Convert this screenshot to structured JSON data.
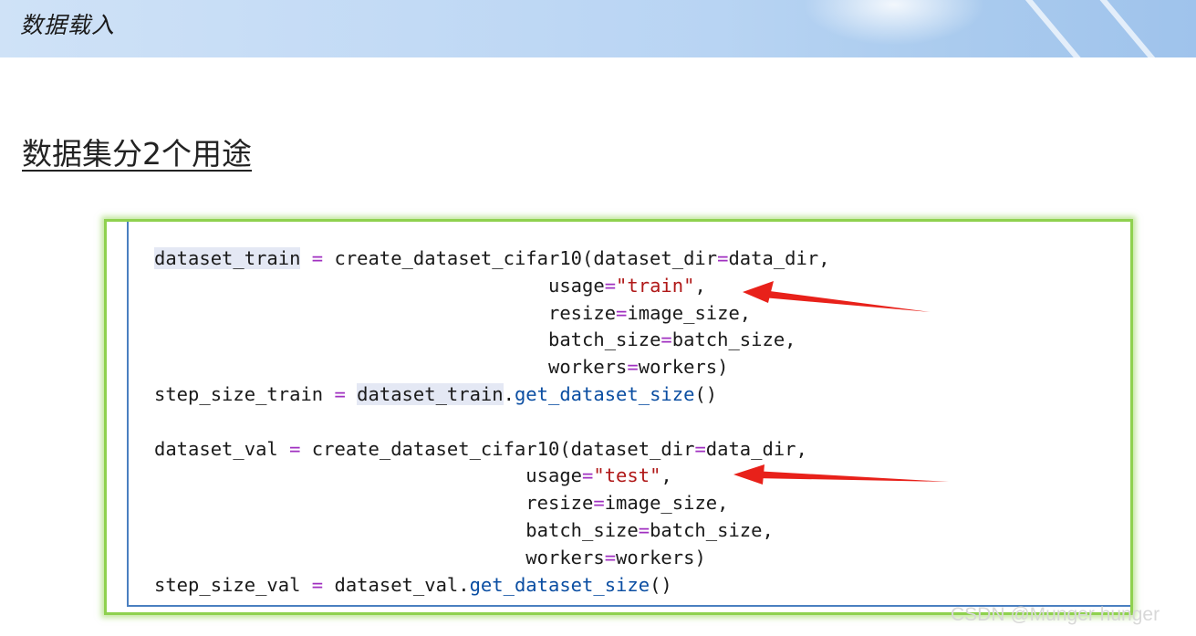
{
  "header": {
    "title": "数据载入"
  },
  "slide": {
    "title": "数据集分2个用途"
  },
  "code": {
    "block1": {
      "var": "dataset_train",
      "eq": "=",
      "call": "create_dataset_cifar10(dataset_dir",
      "eq2": "=",
      "arg1": "data_dir,",
      "usage_kw": "usage",
      "usage_eq": "=",
      "usage_val": "\"train\"",
      "usage_tail": ",",
      "resize_kw": "resize",
      "resize_eq": "=",
      "resize_val": "image_size,",
      "batch_kw": "batch_size",
      "batch_eq": "=",
      "batch_val": "batch_size,",
      "workers_kw": "workers",
      "workers_eq": "=",
      "workers_val": "workers)",
      "step_var": "step_size_train",
      "step_eq": "=",
      "step_obj": "dataset_train",
      "step_dot": ".",
      "step_fn": "get_dataset_size",
      "step_tail": "()"
    },
    "block2": {
      "var": "dataset_val",
      "eq": "=",
      "call": "create_dataset_cifar10(dataset_dir",
      "eq2": "=",
      "arg1": "data_dir,",
      "usage_kw": "usage",
      "usage_eq": "=",
      "usage_val": "\"test\"",
      "usage_tail": ",",
      "resize_kw": "resize",
      "resize_eq": "=",
      "resize_val": "image_size,",
      "batch_kw": "batch_size",
      "batch_eq": "=",
      "batch_val": "batch_size,",
      "workers_kw": "workers",
      "workers_eq": "=",
      "workers_val": "workers)",
      "step_var": "step_size_val",
      "step_eq": "=",
      "step_obj": "dataset_val.",
      "step_fn": "get_dataset_size",
      "step_tail": "()"
    }
  },
  "annotations": {
    "arrow_color": "#e8211a"
  },
  "watermark": {
    "text": "CSDN @Munger hunger"
  },
  "colors": {
    "panel_border": "#8fd14f",
    "operator": "#a030c0",
    "function": "#0b4ea2",
    "string": "#b01818"
  }
}
